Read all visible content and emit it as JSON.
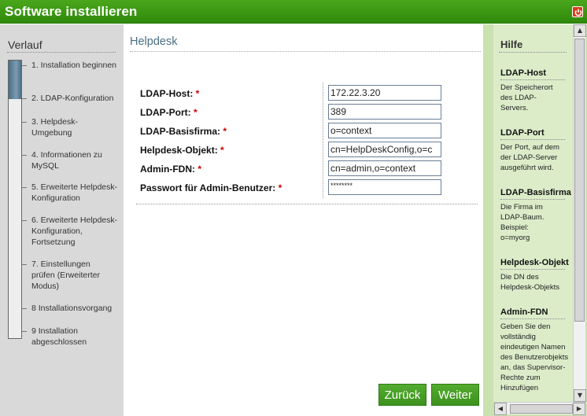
{
  "window": {
    "title": "Software installieren"
  },
  "sidebar": {
    "heading": "Verlauf",
    "progress_fraction": 0.14,
    "steps": [
      "1. Installation beginnen",
      "2. LDAP-Konfiguration",
      "3. Helpdesk-Umgebung",
      "4. Informationen zu MySQL",
      "5. Erweiterte Helpdesk-Konfiguration",
      "6. Erweiterte Helpdesk-Konfiguration, Fortsetzung",
      "7. Einstellungen prüfen (Erweiterter Modus)",
      "8 Installationsvorgang",
      "9 Installation abgeschlossen"
    ]
  },
  "main": {
    "heading": "Helpdesk",
    "required_marker": "*",
    "fields": [
      {
        "label": "LDAP-Host:",
        "value": "172.22.3.20"
      },
      {
        "label": "LDAP-Port:",
        "value": "389"
      },
      {
        "label": "LDAP-Basisfirma:",
        "value": "o=context"
      },
      {
        "label": "Helpdesk-Objekt:",
        "value": "cn=HelpDeskConfig,o=c"
      },
      {
        "label": "Admin-FDN:",
        "value": "cn=admin,o=context"
      },
      {
        "label": "Passwort für Admin-Benutzer:",
        "value": "********"
      }
    ],
    "back_label": "Zurück",
    "next_label": "Weiter"
  },
  "help": {
    "heading": "Hilfe",
    "items": [
      {
        "title": "LDAP-Host",
        "desc": "Der Speicherort des LDAP-Servers."
      },
      {
        "title": "LDAP-Port",
        "desc": "Der Port, auf dem der LDAP-Server ausgeführt wird."
      },
      {
        "title": "LDAP-Basisfirma",
        "desc": "Die Firma im LDAP-Baum. Beispiel: o=myorg"
      },
      {
        "title": "Helpdesk-Objekt",
        "desc": "Die DN des Helpdesk-Objekts"
      },
      {
        "title": "Admin-FDN",
        "desc": "Geben Sie den vollständig eindeutigen Namen des Benutzerobjekts an, das Supervisor-Rechte zum Hinzufügen"
      }
    ]
  },
  "colors": {
    "titlebar": "#3a9a14",
    "accent_text": "#4a6e86",
    "button": "#4aa228",
    "help_bg": "#dcecc9"
  }
}
